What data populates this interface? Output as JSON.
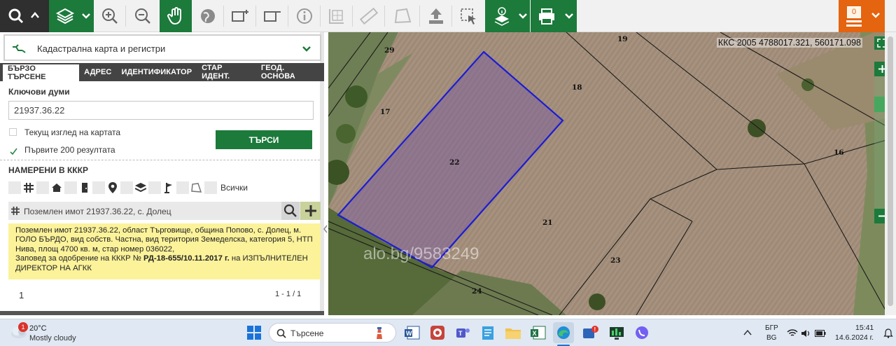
{
  "toolbar": {
    "user_badge": "0"
  },
  "sidebar": {
    "layer_label": "Кадастрална карта и регистри",
    "tabs": [
      {
        "label": "БЪРЗО ТЪРСЕНЕ"
      },
      {
        "label": "АДРЕС"
      },
      {
        "label": "ИДЕНТИФИКАТОР"
      },
      {
        "label": "СТАР ИДЕНТ."
      },
      {
        "label": "ГЕОД. ОСНОВА"
      }
    ],
    "keywords_label": "Ключови думи",
    "keywords_value": "21937.36.22",
    "current_view_label": "Текущ изглед на картата",
    "first200_label": "Първите 200 резултата",
    "search_button": "ТЪРСИ",
    "found_label": "НАМЕРЕНИ В КККР",
    "filter_all_label": "Всички",
    "result_title": "Поземлен имот 21937.36.22, с. Долец",
    "result_detail_line1": "Поземлен имот 21937.36.22, област Търговище, община Попово, с. Долец, м. ГОЛО БЪРДО, вид собств. Частна, вид територия Земеделска, категория 5, НТП Нива, площ 4700 кв. м, стар номер 036022,",
    "result_detail_pre": "Заповед за одобрение на КККР №",
    "result_detail_order": "РД-18-655/10.11.2017 г.",
    "result_detail_post": "на ИЗПЪЛНИТЕЛЕН ДИРЕКТОР НА АГКК",
    "page_num": "1",
    "page_range": "1 - 1 / 1"
  },
  "map": {
    "coords": "ККС 2005 4788017.321, 560171.098",
    "parcel_labels": [
      "29",
      "19",
      "18",
      "17",
      "22",
      "16",
      "21",
      "23",
      "24"
    ],
    "watermark": "alo.bg/9583249"
  },
  "taskbar": {
    "weather_temp": "20°C",
    "weather_desc": "Mostly cloudy",
    "weather_badge": "1",
    "search_placeholder": "Търсене",
    "lang_top": "БГР",
    "lang_bottom": "BG",
    "time": "15:41",
    "date": "14.6.2024 г."
  }
}
